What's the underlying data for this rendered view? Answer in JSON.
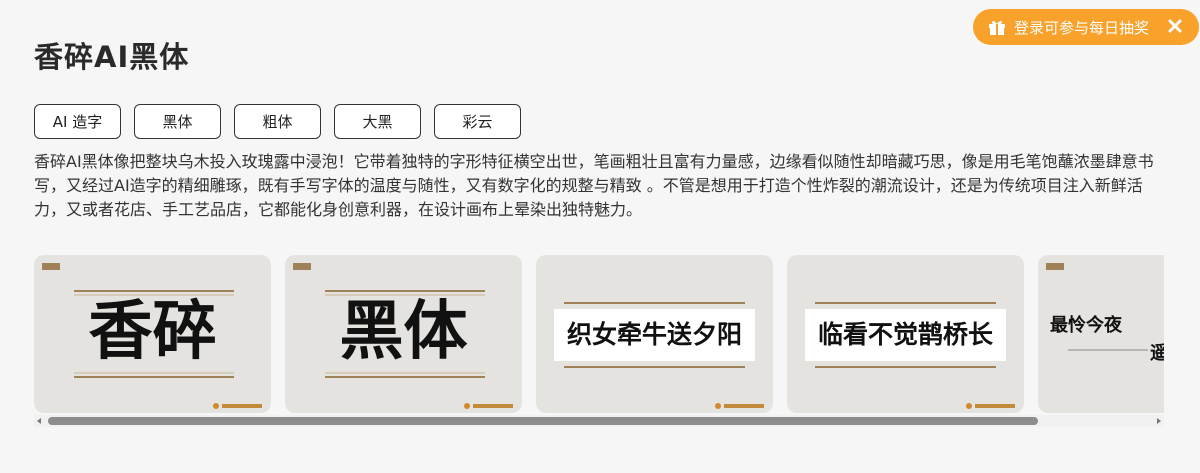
{
  "page": {
    "title": "香碎AI黑体"
  },
  "promo": {
    "label": "登录可参与每日抽奖",
    "color": "#f8a22b"
  },
  "tags": [
    {
      "label": "AI 造字"
    },
    {
      "label": "黑体"
    },
    {
      "label": "粗体"
    },
    {
      "label": "大黑"
    },
    {
      "label": "彩云"
    }
  ],
  "description": "香碎AI黑体像把整块乌木投入玫瑰露中浸泡！它带着独特的字形特征横空出世，笔画粗壮且富有力量感，边缘看似随性却暗藏巧思，像是用毛笔饱蘸浓墨肆意书写，又经过AI造字的精细雕琢，既有手写字体的温度与随性，又有数字化的规整与精致 。不管是想用于打造个性炸裂的潮流设计，还是为传统项目注入新鲜活力，又或者花店、手工艺品店，它都能化身创意利器，在设计画布上晕染出独特魅力。",
  "gallery": {
    "cards": [
      {
        "text": "香碎",
        "icon": "font-preview"
      },
      {
        "text": "黑体",
        "icon": "font-preview"
      },
      {
        "text": "织女牵牛送夕阳",
        "icon": "font-preview"
      },
      {
        "text": "临看不觉鹊桥长",
        "icon": "font-preview"
      },
      {
        "text": "最怜今夜",
        "subtext": "遥",
        "icon": "font-preview"
      }
    ]
  }
}
